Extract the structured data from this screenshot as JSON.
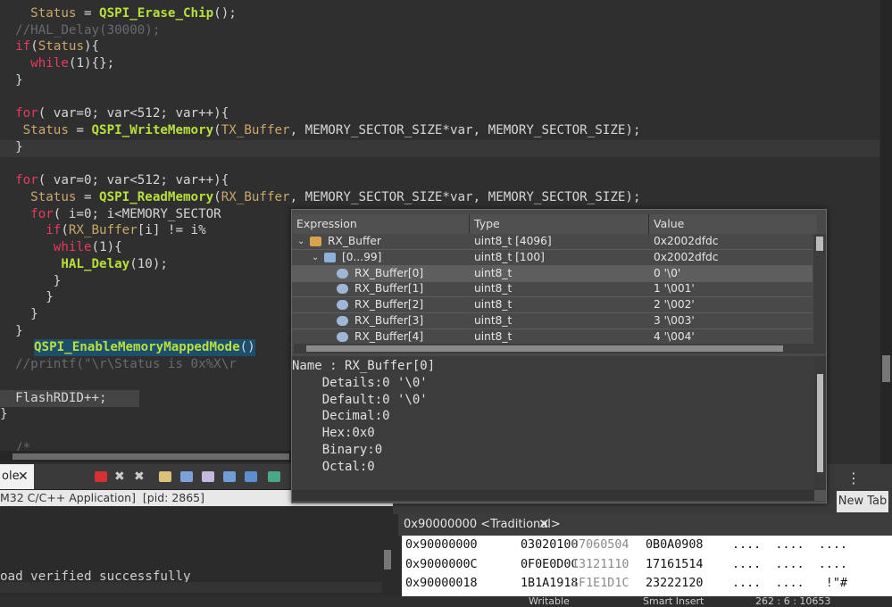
{
  "editor": {
    "lines": [
      {
        "indent": "    ",
        "parts": [
          [
            "var",
            "Status"
          ],
          [
            "txt",
            " = "
          ],
          [
            "fn",
            "QSPI_Erase_Chip"
          ],
          [
            "txt",
            "();"
          ]
        ]
      },
      {
        "indent": "  ",
        "parts": [
          [
            "cm",
            "//HAL_Delay(30000);"
          ]
        ]
      },
      {
        "indent": "  ",
        "parts": [
          [
            "kw",
            "if"
          ],
          [
            "txt",
            "("
          ],
          [
            "var",
            "Status"
          ],
          [
            "txt",
            "){"
          ]
        ]
      },
      {
        "indent": "    ",
        "parts": [
          [
            "kw",
            "while"
          ],
          [
            "txt",
            "("
          ],
          [
            "num",
            "1"
          ],
          [
            "txt",
            "){};"
          ]
        ]
      },
      {
        "indent": "  ",
        "parts": [
          [
            "txt",
            "}"
          ]
        ]
      },
      {
        "indent": "",
        "parts": []
      },
      {
        "indent": "  ",
        "parts": [
          [
            "kw",
            "for"
          ],
          [
            "txt",
            "( var=0; var<512; var++){"
          ]
        ]
      },
      {
        "indent": "   ",
        "parts": [
          [
            "var",
            "Status"
          ],
          [
            "txt",
            " = "
          ],
          [
            "fn",
            "QSPI_WriteMemory"
          ],
          [
            "txt",
            "("
          ],
          [
            "var",
            "TX_Buffer"
          ],
          [
            "txt",
            ", MEMORY_SECTOR_SIZE*var, MEMORY_SECTOR_SIZE);"
          ]
        ]
      },
      {
        "indent": "  ",
        "parts": [
          [
            "txt",
            "}"
          ]
        ]
      },
      {
        "indent": "",
        "parts": []
      },
      {
        "indent": "  ",
        "parts": [
          [
            "kw",
            "for"
          ],
          [
            "txt",
            "( var=0; var<512; var++){"
          ]
        ]
      },
      {
        "indent": "    ",
        "parts": [
          [
            "var",
            "Status"
          ],
          [
            "txt",
            " = "
          ],
          [
            "fn",
            "QSPI_ReadMemory"
          ],
          [
            "txt",
            "("
          ],
          [
            "var",
            "RX_Buffer"
          ],
          [
            "txt",
            ", MEMORY_SECTOR_SIZE*var, MEMORY_SECTOR_SIZE);"
          ]
        ]
      },
      {
        "indent": "    ",
        "parts": [
          [
            "kw",
            "for"
          ],
          [
            "txt",
            "( i=0; i<MEMORY_SECTOR"
          ]
        ]
      },
      {
        "indent": "      ",
        "parts": [
          [
            "kw",
            "if"
          ],
          [
            "txt",
            "("
          ],
          [
            "var",
            "RX_Buffer"
          ],
          [
            "txt",
            "[i] != i%"
          ]
        ]
      },
      {
        "indent": "       ",
        "parts": [
          [
            "kw",
            "while"
          ],
          [
            "txt",
            "("
          ],
          [
            "num",
            "1"
          ],
          [
            "txt",
            "){"
          ]
        ]
      },
      {
        "indent": "        ",
        "parts": [
          [
            "fn",
            "HAL_Delay"
          ],
          [
            "txt",
            "(10);"
          ]
        ]
      },
      {
        "indent": "       ",
        "parts": [
          [
            "txt",
            "}"
          ]
        ]
      },
      {
        "indent": "      ",
        "parts": [
          [
            "txt",
            "}"
          ]
        ]
      },
      {
        "indent": "    ",
        "parts": [
          [
            "txt",
            "}"
          ]
        ]
      },
      {
        "indent": "  ",
        "parts": [
          [
            "txt",
            "}"
          ]
        ]
      },
      {
        "indent": "  ",
        "parts": [
          [
            "fn",
            "QSPI_EnableMemoryMappedMode"
          ],
          [
            "txt",
            "()"
          ]
        ]
      },
      {
        "indent": "  ",
        "parts": [
          [
            "cm",
            "//printf(\"\\r\\Status is 0x%X\\r"
          ]
        ]
      },
      {
        "indent": "",
        "parts": []
      },
      {
        "indent": "  ",
        "parts": [
          [
            "txt",
            "FlashRDID++;"
          ]
        ]
      },
      {
        "indent": "",
        "parts": [
          [
            "txt",
            "}"
          ]
        ]
      },
      {
        "indent": "",
        "parts": []
      },
      {
        "indent": "  ",
        "parts": [
          [
            "cm",
            "/*"
          ]
        ]
      }
    ]
  },
  "console": {
    "tab_label": "ole",
    "subtitle": "M32 C/C++ Application]  [pid: 2865]",
    "output": "oad verified successfully"
  },
  "memory": {
    "new_tab_label": "New Tab",
    "tab_label": "0x90000000 <Traditional>",
    "rows": [
      {
        "addr": "0x90000000",
        "w1": "03020100",
        "w2": "07060504",
        "w3": "0B0A0908",
        "ascii": "....  ....  ...."
      },
      {
        "addr": "0x9000000C",
        "w1": "0F0E0D0C",
        "w2": "13121110",
        "w3": "17161514",
        "ascii": "....  ....  ...."
      },
      {
        "addr": "0x90000018",
        "w1": "1B1A1918",
        "w2": "1F1E1D1C",
        "w3": "23222120",
        "ascii": "....  ....   !\"#"
      }
    ]
  },
  "status": {
    "writable": "Writable",
    "insert": "Smart Insert",
    "pos": "262 : 6 : 10653"
  },
  "popup": {
    "headers": {
      "expression": "Expression",
      "type": "Type",
      "value": "Value"
    },
    "rows": [
      {
        "indent": 0,
        "arrow": "⌄",
        "icon": "struct-icon",
        "expr": "RX_Buffer",
        "type": "uint8_t [4096]",
        "value": "0x2002dfdc"
      },
      {
        "indent": 1,
        "arrow": "⌄",
        "icon": "array-icon",
        "expr": "[0...99]",
        "type": "uint8_t [100]",
        "value": "0x2002dfdc"
      },
      {
        "indent": 2,
        "arrow": "",
        "icon": "element-icon",
        "expr": "RX_Buffer[0]",
        "type": "uint8_t",
        "value": "0 '\\0'"
      },
      {
        "indent": 2,
        "arrow": "",
        "icon": "element-icon",
        "expr": "RX_Buffer[1]",
        "type": "uint8_t",
        "value": "1 '\\001'"
      },
      {
        "indent": 2,
        "arrow": "",
        "icon": "element-icon",
        "expr": "RX_Buffer[2]",
        "type": "uint8_t",
        "value": "2 '\\002'"
      },
      {
        "indent": 2,
        "arrow": "",
        "icon": "element-icon",
        "expr": "RX_Buffer[3]",
        "type": "uint8_t",
        "value": "3 '\\003'"
      },
      {
        "indent": 2,
        "arrow": "",
        "icon": "element-icon",
        "expr": "RX_Buffer[4]",
        "type": "uint8_t",
        "value": "4 '\\004'"
      }
    ],
    "details": [
      "Name : RX_Buffer[0]",
      "    Details:0 '\\0'",
      "    Default:0 '\\0'",
      "    Decimal:0",
      "    Hex:0x0",
      "    Binary:0",
      "    Octal:0"
    ]
  }
}
